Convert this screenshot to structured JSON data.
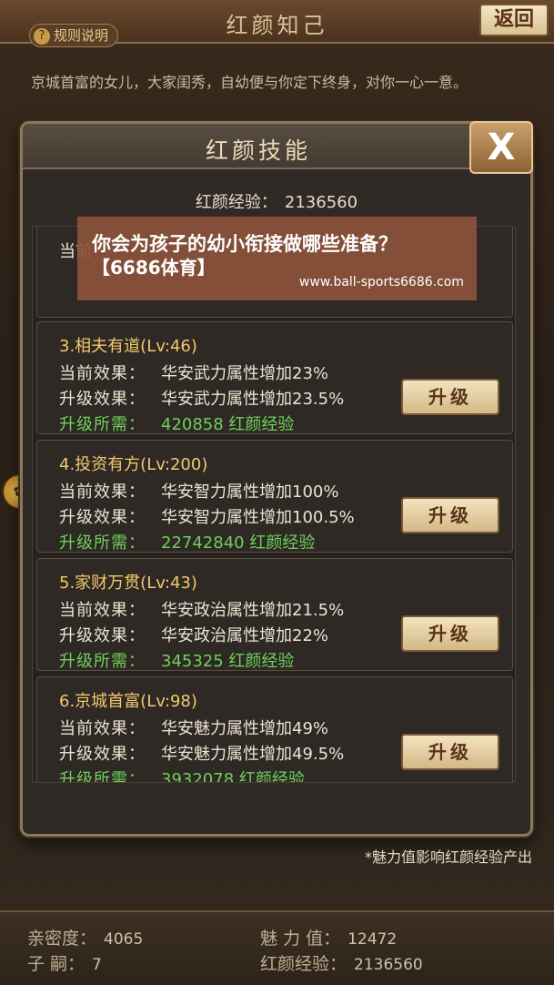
{
  "screen": {
    "title": "红颜知己",
    "back_label": "返回",
    "rules_label": "规则说明",
    "rules_icon": "?",
    "bio": "京城首富的女儿，大家闺秀，自幼便与你定下终身，对你一心一意。"
  },
  "dialog": {
    "title": "红颜技能",
    "close_label": "X",
    "exp_label": "红颜经验：",
    "exp_value": "2136560",
    "partial_row_label": "当前",
    "skills": [
      {
        "title": "3.相夫有道(Lv:46)",
        "current_label": "当前效果：",
        "current_value": "华安武力属性增加23%",
        "next_label": "升级效果：",
        "next_value": "华安武力属性增加23.5%",
        "req_label": "升级所需：",
        "req_value": "420858  红颜经验",
        "button": "升级"
      },
      {
        "title": "4.投资有方(Lv:200)",
        "current_label": "当前效果：",
        "current_value": "华安智力属性增加100%",
        "next_label": "升级效果：",
        "next_value": "华安智力属性增加100.5%",
        "req_label": "升级所需：",
        "req_value": "22742840  红颜经验",
        "button": "升级"
      },
      {
        "title": "5.家财万贯(Lv:43)",
        "current_label": "当前效果：",
        "current_value": "华安政治属性增加21.5%",
        "next_label": "升级效果：",
        "next_value": "华安政治属性增加22%",
        "req_label": "升级所需：",
        "req_value": "345325  红颜经验",
        "button": "升级"
      },
      {
        "title": "6.京城首富(Lv:98)",
        "current_label": "当前效果：",
        "current_value": "华安魅力属性增加49%",
        "next_label": "升级效果：",
        "next_value": "华安魅力属性增加49.5%",
        "req_label": "升级所需：",
        "req_value": "3932078  红颜经验",
        "button": "升级"
      }
    ],
    "footnote": "*魅力值影响红颜经验产出"
  },
  "stats": {
    "intimacy_label": "亲密度：",
    "intimacy_value": "4065",
    "children_label": "子   嗣：",
    "children_value": "7",
    "charm_label": "魅 力 值：",
    "charm_value": "12472",
    "exp_label": "红颜经验：",
    "exp_value": "2136560"
  },
  "banner": {
    "line1": "你会为孩子的幼小衔接做哪些准备？",
    "line2": "【6686体育】",
    "url": "www.ball-sports6686.com"
  },
  "side_icon_glyph": "✿"
}
